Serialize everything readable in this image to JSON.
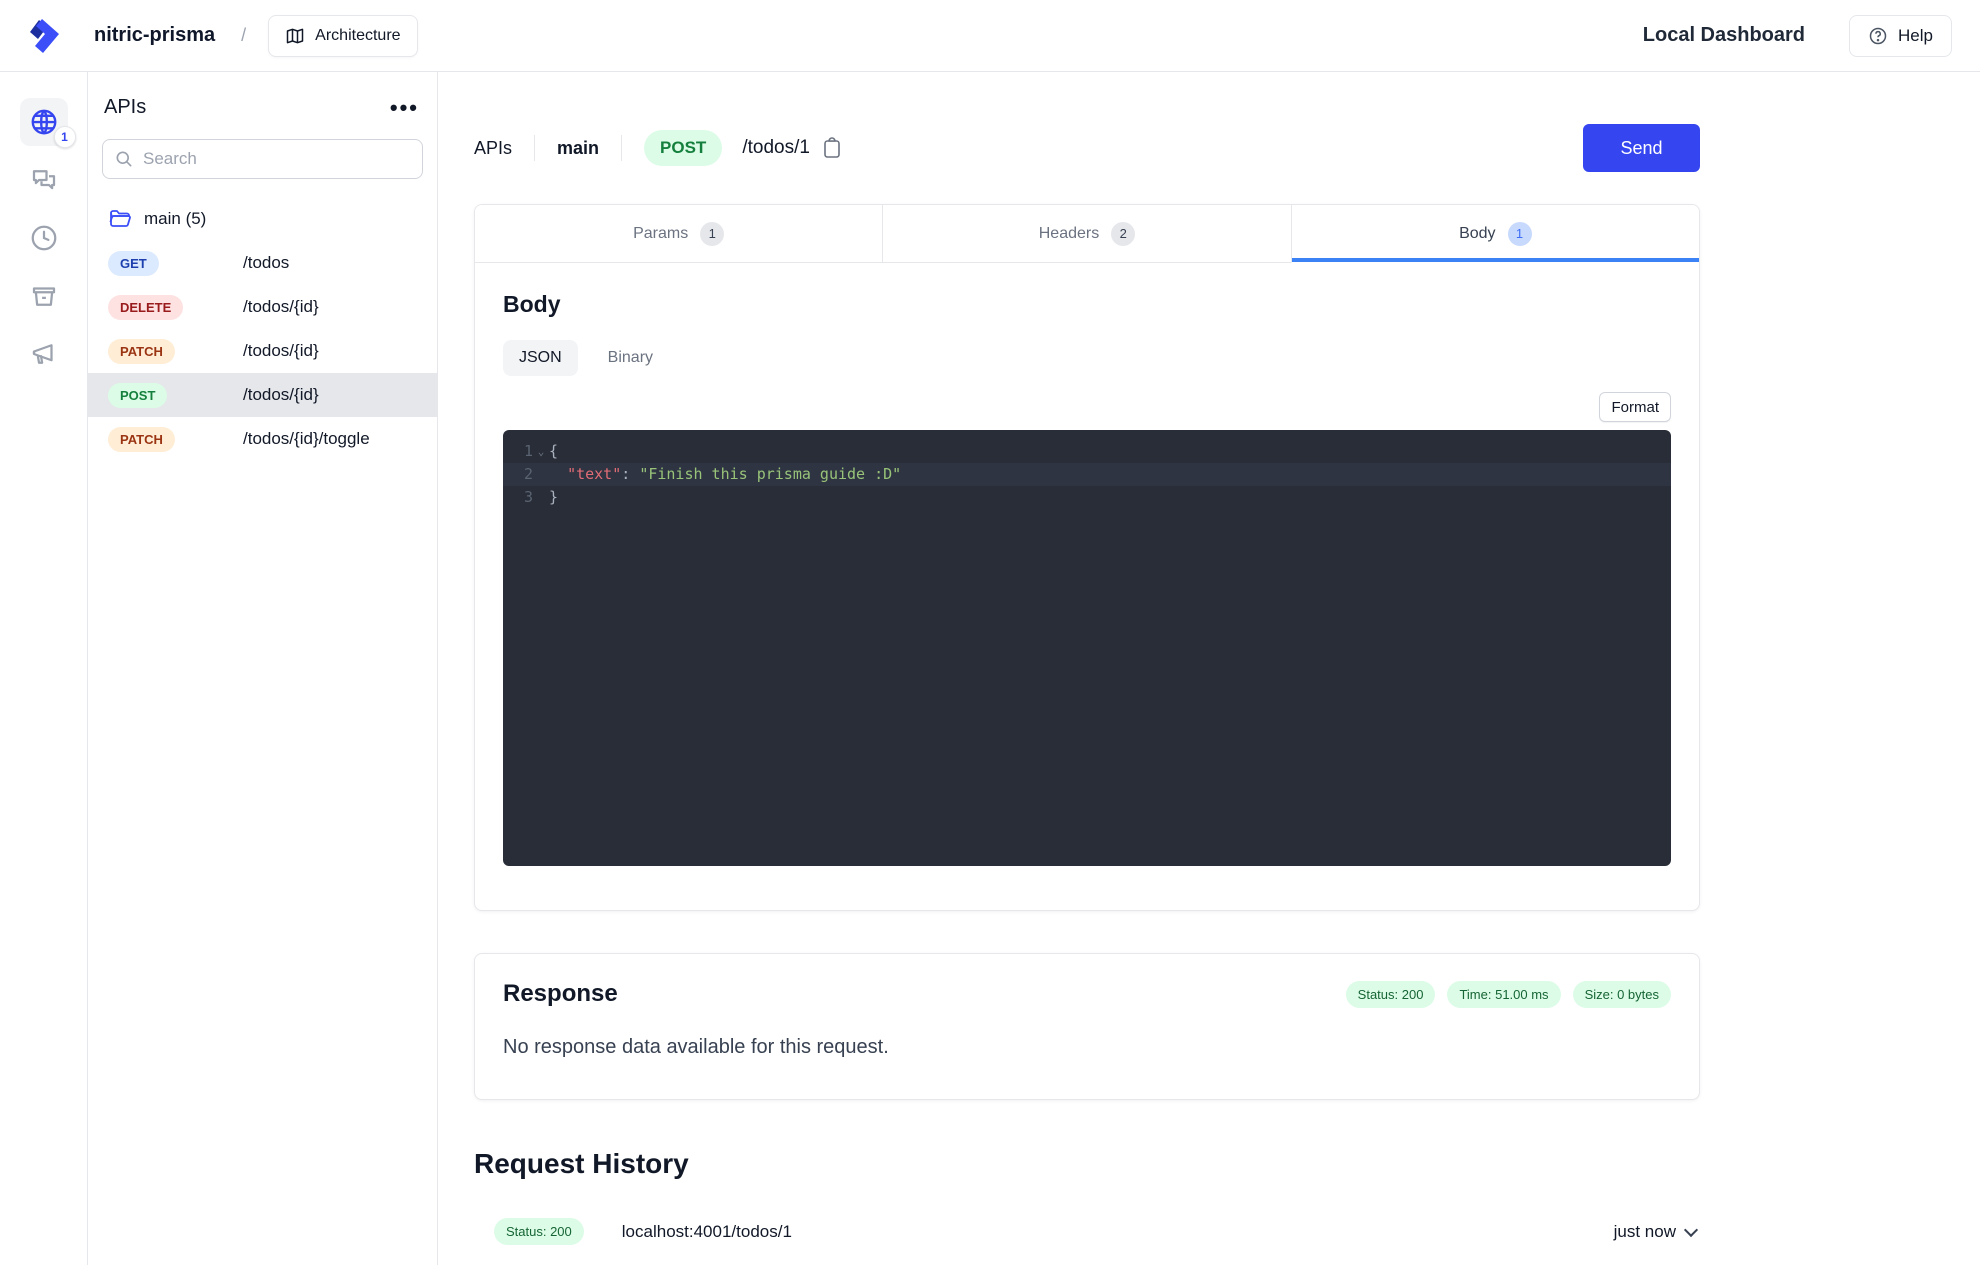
{
  "header": {
    "project_name": "nitric-prisma",
    "separator": "/",
    "architecture_label": "Architecture",
    "dashboard_label": "Local Dashboard",
    "help_label": "Help"
  },
  "rail": {
    "apis_badge": "1"
  },
  "sidebar": {
    "title": "APIs",
    "search_placeholder": "Search",
    "group_label": "main (5)",
    "routes": [
      {
        "method": "GET",
        "path": "/todos"
      },
      {
        "method": "DELETE",
        "path": "/todos/{id}"
      },
      {
        "method": "PATCH",
        "path": "/todos/{id}"
      },
      {
        "method": "POST",
        "path": "/todos/{id}"
      },
      {
        "method": "PATCH",
        "path": "/todos/{id}/toggle"
      }
    ]
  },
  "request_bar": {
    "breadcrumb_root": "APIs",
    "api_name": "main",
    "method": "POST",
    "path": "/todos/1",
    "send_label": "Send"
  },
  "tabs": [
    {
      "label": "Params",
      "count": "1"
    },
    {
      "label": "Headers",
      "count": "2"
    },
    {
      "label": "Body",
      "count": "1"
    }
  ],
  "body_panel": {
    "title": "Body",
    "mode_json": "JSON",
    "mode_binary": "Binary",
    "format_label": "Format",
    "editor": {
      "num1": "1",
      "num2": "2",
      "num3": "3",
      "fold": "⌄",
      "line1": "{",
      "line2_indent": "  ",
      "line2_key": "\"text\"",
      "line2_sep": ": ",
      "line2_value": "\"Finish this prisma guide :D\"",
      "line3": "}"
    }
  },
  "response": {
    "title": "Response",
    "status": "Status: 200",
    "time": "Time: 51.00 ms",
    "size": "Size: 0 bytes",
    "empty_message": "No response data available for this request."
  },
  "history": {
    "title": "Request History",
    "item": {
      "status": "Status: 200",
      "url": "localhost:4001/todos/1",
      "time": "just now"
    }
  },
  "colors": {
    "accent_blue": "#3545ef",
    "tab_underline": "#3b82f6",
    "success_bg": "#dcfce7",
    "success_text": "#166534",
    "editor_bg": "#282d37",
    "token_key": "#e06c75",
    "token_string": "#98c379"
  }
}
